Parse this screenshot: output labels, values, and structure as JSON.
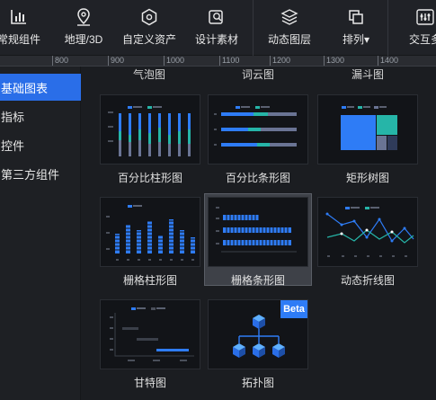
{
  "toolbar": {
    "items": [
      {
        "label": "常规组件",
        "icon": "bar-chart-icon"
      },
      {
        "label": "地理/3D",
        "icon": "map-pin-icon"
      },
      {
        "label": "自定义资产",
        "icon": "hexagon-icon"
      },
      {
        "label": "设计素材",
        "icon": "search-image-icon"
      },
      {
        "label": "动态图层",
        "icon": "layers-icon"
      },
      {
        "label": "排列",
        "icon": "arrange-icon"
      },
      {
        "label": "交互多",
        "icon": "interaction-icon"
      }
    ],
    "arrange_caret": "▾"
  },
  "ruler": {
    "ticks": [
      "800",
      "900",
      "1000",
      "1100",
      "1200",
      "1300",
      "1400"
    ]
  },
  "sidebar": {
    "items": [
      {
        "label": "基础图表",
        "active": true
      },
      {
        "label": "指标",
        "active": false
      },
      {
        "label": "控件",
        "active": false
      },
      {
        "label": "第三方组件",
        "active": false
      }
    ]
  },
  "content": {
    "top_labels": [
      "气泡图",
      "词云图",
      "漏斗图"
    ],
    "cards": [
      {
        "label": "百分比柱形图",
        "thumb": "percent-column"
      },
      {
        "label": "百分比条形图",
        "thumb": "percent-bar"
      },
      {
        "label": "矩形树图",
        "thumb": "treemap"
      },
      {
        "label": "栅格柱形图",
        "thumb": "grid-column"
      },
      {
        "label": "栅格条形图",
        "thumb": "grid-bar",
        "selected": true
      },
      {
        "label": "动态折线图",
        "thumb": "dynamic-line"
      },
      {
        "label": "甘特图",
        "thumb": "gantt"
      },
      {
        "label": "拓扑图",
        "thumb": "topology",
        "badge": "Beta"
      }
    ]
  },
  "colors": {
    "accent": "#2a6ee8",
    "blue": "#2e7cf6",
    "teal": "#26b5a8",
    "slate": "#6a7494"
  }
}
